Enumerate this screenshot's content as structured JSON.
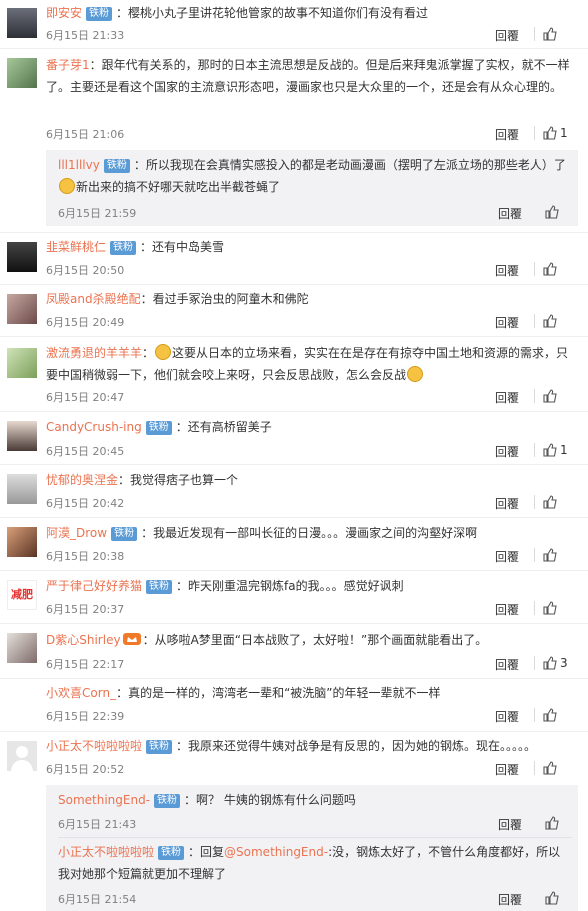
{
  "badge": "铁粉",
  "reply_label": "回覆",
  "comments": [
    {
      "user": "即安安",
      "text": "：樱桃小丸子里讲花轮他管家的故事不知道你们有没有看过",
      "time": "6月15日 21:33",
      "likes": ""
    },
    {
      "user": "番子芽1",
      "text": "：跟年代有关系的，那时的日本主流思想是反战的。但是后来拜鬼派掌握了实权，就不一样了。主要还是看这个国家的主流意识形态吧，漫画家也只是大众里的一个，还是会有从众心理的。",
      "time": "6月15日 21:06",
      "likes": "1",
      "subs": [
        {
          "user": "lll1lllvy",
          "text_a": "：所以我现在会真情实感投入的都是老动画漫画（摆明了左派立场的那些老人）了",
          "text_b": "新出来的搞不好哪天就吃出半截苍蝇了",
          "time": "6月15日 21:59"
        }
      ]
    },
    {
      "user": "韭菜鲜桃仁",
      "text": "：还有中岛美雪",
      "time": "6月15日 20:50",
      "likes": ""
    },
    {
      "user": "凤殿and杀殿绝配",
      "text": "：看过手冢治虫的阿童木和佛陀",
      "time": "6月15日 20:49",
      "likes": ""
    },
    {
      "user": "激流勇退的羊羊羊",
      "text_b": "这要从日本的立场来看，实实在在是存在有掠夺中国土地和资源的需求，只要中国稍微弱一下，他们就会咬上来呀，只会反思战败，怎么会反战",
      "time": "6月15日 20:47",
      "likes": ""
    },
    {
      "user": "CandyCrush-ing",
      "text": "：还有高桥留美子",
      "time": "6月15日 20:45",
      "likes": "1"
    },
    {
      "user": "忧郁的奥涅金",
      "text": "：我觉得痞子也算一个",
      "time": "6月15日 20:42",
      "likes": ""
    },
    {
      "user": "阿漠_Drow",
      "text": "：我最近发现有一部叫长征的日漫。。。漫画家之间的沟壑好深啊",
      "time": "6月15日 20:38",
      "likes": ""
    },
    {
      "user": "严于律己好好养猫",
      "text": "：昨天刚重温完钢炼fa的我。。。感觉好讽刺",
      "time": "6月15日 20:37",
      "likes": ""
    },
    {
      "user": "D紫心Shirley",
      "text": "：从哆啦A梦里面“日本战败了，太好啦！”那个画面就能看出了。",
      "time": "6月15日 22:17",
      "likes": "3"
    },
    {
      "user": "小欢喜Corn_",
      "text": "：真的是一样的，湾湾老一辈和“被洗脑”的年轻一辈就不一样",
      "time": "6月15日 22:39",
      "likes": ""
    },
    {
      "user": "小正太不啦啦啦啦",
      "text": "：我原来还觉得牛姨对战争是有反思的，因为她的钢炼。现在。。。。。",
      "time": "6月15日 20:52",
      "likes": "",
      "subs": [
        {
          "user": "SomethingEnd-",
          "text_a": "：啊？ 牛姨的钢炼有什么问题吗",
          "time": "6月15日 21:43"
        },
        {
          "user": "小正太不啦啦啦啦",
          "text_a": "：回复",
          "mention": "@SomethingEnd-",
          "text_b": ":没，钢炼太好了，不管什么角度都好，所以我对她那个短篇就更加不理解了",
          "time": "6月15日 21:54"
        }
      ]
    }
  ],
  "avatar_badge_text": "减肥"
}
